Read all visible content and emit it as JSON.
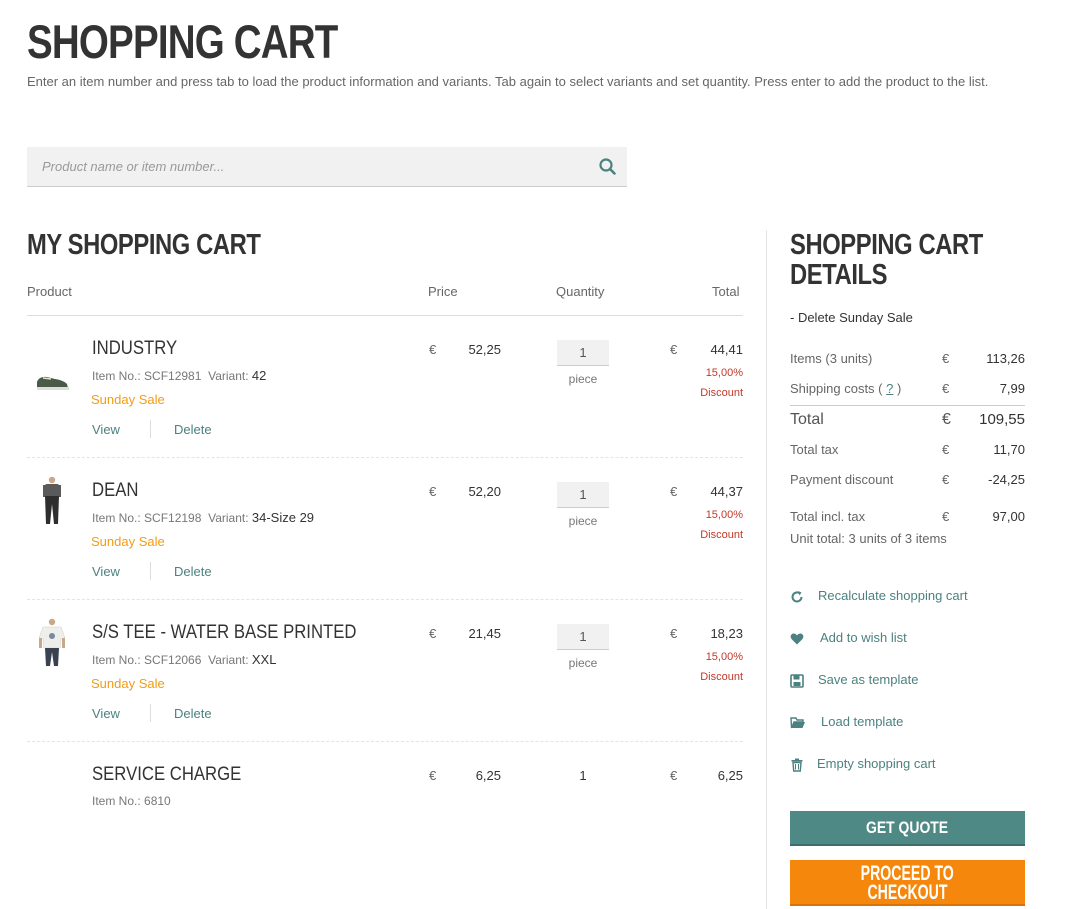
{
  "page": {
    "title": "SHOPPING CART",
    "intro": "Enter an item number and press tab to load the product information and variants. Tab again to select variants and set quantity. Press enter to add the product to the list."
  },
  "search": {
    "placeholder": "Product name or item number..."
  },
  "cart": {
    "title": "MY SHOPPING CART",
    "headers": {
      "product": "Product",
      "price": "Price",
      "quantity": "Quantity",
      "total": "Total"
    },
    "currency": "€",
    "item_no_label": "Item No.:",
    "variant_label": "Variant:",
    "view_label": "View",
    "delete_label": "Delete",
    "items": [
      {
        "name": "INDUSTRY",
        "item_no": "SCF12981",
        "variant": "42",
        "sale": "Sunday Sale",
        "price": "52,25",
        "qty": "1",
        "unit": "piece",
        "total": "44,41",
        "discount_pct": "15,00%",
        "discount_label": "Discount",
        "thumb": "sneaker-icon"
      },
      {
        "name": "DEAN",
        "item_no": "SCF12198",
        "variant": "34-Size 29",
        "sale": "Sunday Sale",
        "price": "52,20",
        "qty": "1",
        "unit": "piece",
        "total": "44,37",
        "discount_pct": "15,00%",
        "discount_label": "Discount",
        "thumb": "jeans-model-icon"
      },
      {
        "name": "S/S TEE - WATER BASE PRINTED",
        "item_no": "SCF12066",
        "variant": "XXL",
        "sale": "Sunday Sale",
        "price": "21,45",
        "qty": "1",
        "unit": "piece",
        "total": "18,23",
        "discount_pct": "15,00%",
        "discount_label": "Discount",
        "thumb": "tshirt-model-icon"
      },
      {
        "name": "SERVICE CHARGE",
        "item_no": "6810",
        "price": "6,25",
        "qty": "1",
        "total": "6,25"
      }
    ]
  },
  "details": {
    "title_line1": "SHOPPING CART",
    "title_line2": "DETAILS",
    "delete_sale": "- Delete Sunday Sale",
    "currency": "€",
    "items_label": "Items (3 units)",
    "items_value": "113,26",
    "shipping_label": "Shipping costs (",
    "shipping_q": "?",
    "shipping_close": ")",
    "shipping_value": "7,99",
    "total_label": "Total",
    "total_value": "109,55",
    "tax_label": "Total tax",
    "tax_value": "11,70",
    "payment_discount_label": "Payment discount",
    "payment_discount_value": "-24,25",
    "total_incl_label": "Total incl. tax",
    "total_incl_value": "97,00",
    "unit_total": "Unit total: 3 units of 3 items"
  },
  "actions": {
    "recalculate": "Recalculate shopping cart",
    "wishlist": "Add to wish list",
    "save_template": "Save as template",
    "load_template": "Load template",
    "empty_cart": "Empty shopping cart"
  },
  "buttons": {
    "quote": "GET QUOTE",
    "checkout_line1": "PROCEED TO",
    "checkout_line2": "CHECKOUT"
  },
  "colors": {
    "accent": "#4e8986",
    "checkout": "#f5880c",
    "sale": "#f39c12",
    "discount": "#c0392b"
  }
}
